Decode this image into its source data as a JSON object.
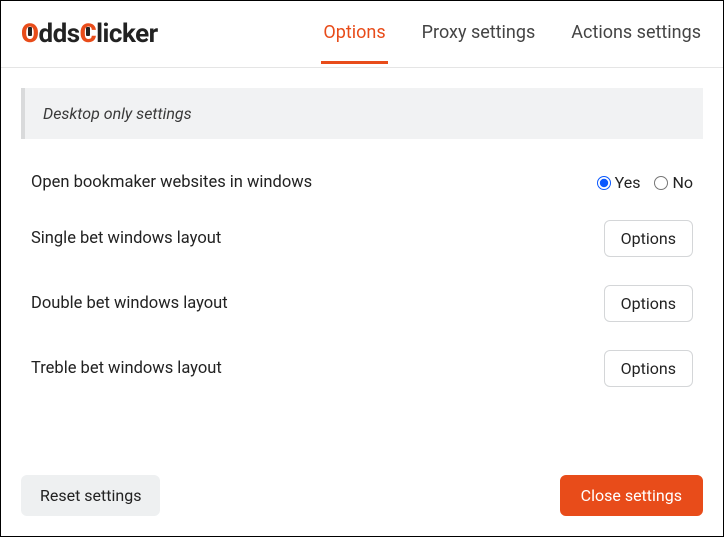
{
  "logo": {
    "part1": "O",
    "part2": "dds",
    "part3": "C",
    "part4": "licker"
  },
  "tabs": {
    "options": "Options",
    "proxy": "Proxy settings",
    "actions": "Actions settings"
  },
  "section": {
    "title": "Desktop only settings"
  },
  "rows": {
    "open_in_windows": {
      "label": "Open bookmaker websites in windows",
      "yes": "Yes",
      "no": "No"
    },
    "single": {
      "label": "Single bet windows layout",
      "button": "Options"
    },
    "double": {
      "label": "Double bet windows layout",
      "button": "Options"
    },
    "treble": {
      "label": "Treble bet windows layout",
      "button": "Options"
    }
  },
  "footer": {
    "reset": "Reset settings",
    "close": "Close settings"
  }
}
